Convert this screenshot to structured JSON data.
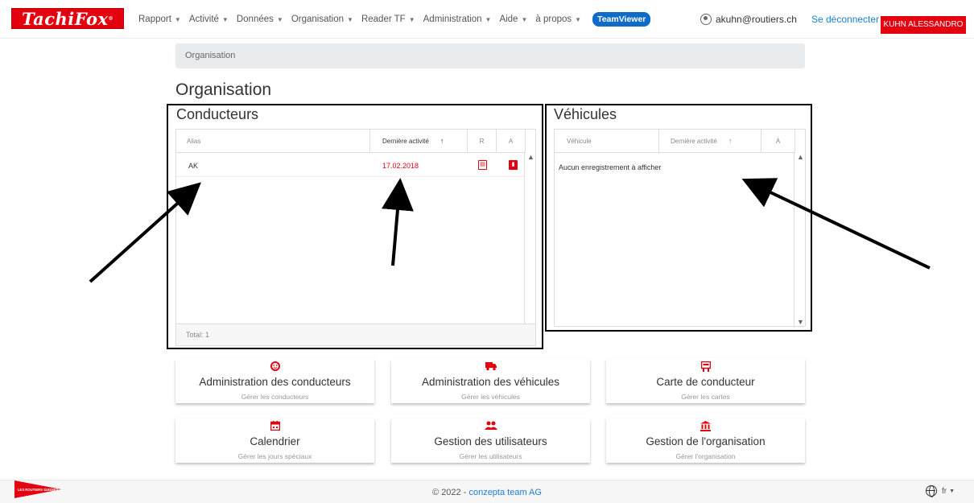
{
  "brand": {
    "logo_text": "TachiFox"
  },
  "nav": {
    "items": [
      {
        "label": "Rapport"
      },
      {
        "label": "Activité"
      },
      {
        "label": "Données"
      },
      {
        "label": "Organisation"
      },
      {
        "label": "Reader TF"
      },
      {
        "label": "Administration"
      },
      {
        "label": "Aide"
      },
      {
        "label": "à propos"
      }
    ],
    "teamviewer": "TeamViewer",
    "user_email": "akuhn@routiers.ch",
    "logout": "Se déconnecter",
    "user_name": "KUHN ALESSANDRO"
  },
  "breadcrumb": "Organisation",
  "page_title": "Organisation",
  "drivers": {
    "title": "Conducteurs",
    "columns": [
      "Alias",
      "Dernière activité",
      "R",
      "A"
    ],
    "sort_arrow": "↑",
    "rows": [
      {
        "alias": "AK",
        "last_activity": "17.02.2018"
      }
    ],
    "total": "Total: 1"
  },
  "vehicles": {
    "title": "Véhicules",
    "columns": [
      "Véhicule",
      "Dernière activité",
      "A"
    ],
    "sort_arrow": "↑",
    "empty": "Aucun enregistrement à afficher"
  },
  "cards": [
    {
      "title": "Administration des conducteurs",
      "subtitle": "Gérer les conducteurs",
      "icon": "driver-face-icon"
    },
    {
      "title": "Administration des véhicules",
      "subtitle": "Gérer les véhicules",
      "icon": "truck-icon"
    },
    {
      "title": "Carte de conducteur",
      "subtitle": "Gérer les cartes",
      "icon": "card-reader-icon"
    },
    {
      "title": "Calendrier",
      "subtitle": "Gérer les jours spéciaux",
      "icon": "calendar-icon"
    },
    {
      "title": "Gestion des utilisateurs",
      "subtitle": "Gérer les utilisateurs",
      "icon": "users-icon"
    },
    {
      "title": "Gestion de l'organisation",
      "subtitle": "Gérer l'organisation",
      "icon": "institution-icon"
    }
  ],
  "footer": {
    "copyright": "© 2022 - ",
    "company": "conzepta team AG",
    "lang": "fr",
    "partner_logo": "LES ROUTIERS SUISSES"
  },
  "colors": {
    "accent": "#e3000f",
    "link": "#1a7fd6",
    "teamviewer": "#0e6bc7"
  }
}
